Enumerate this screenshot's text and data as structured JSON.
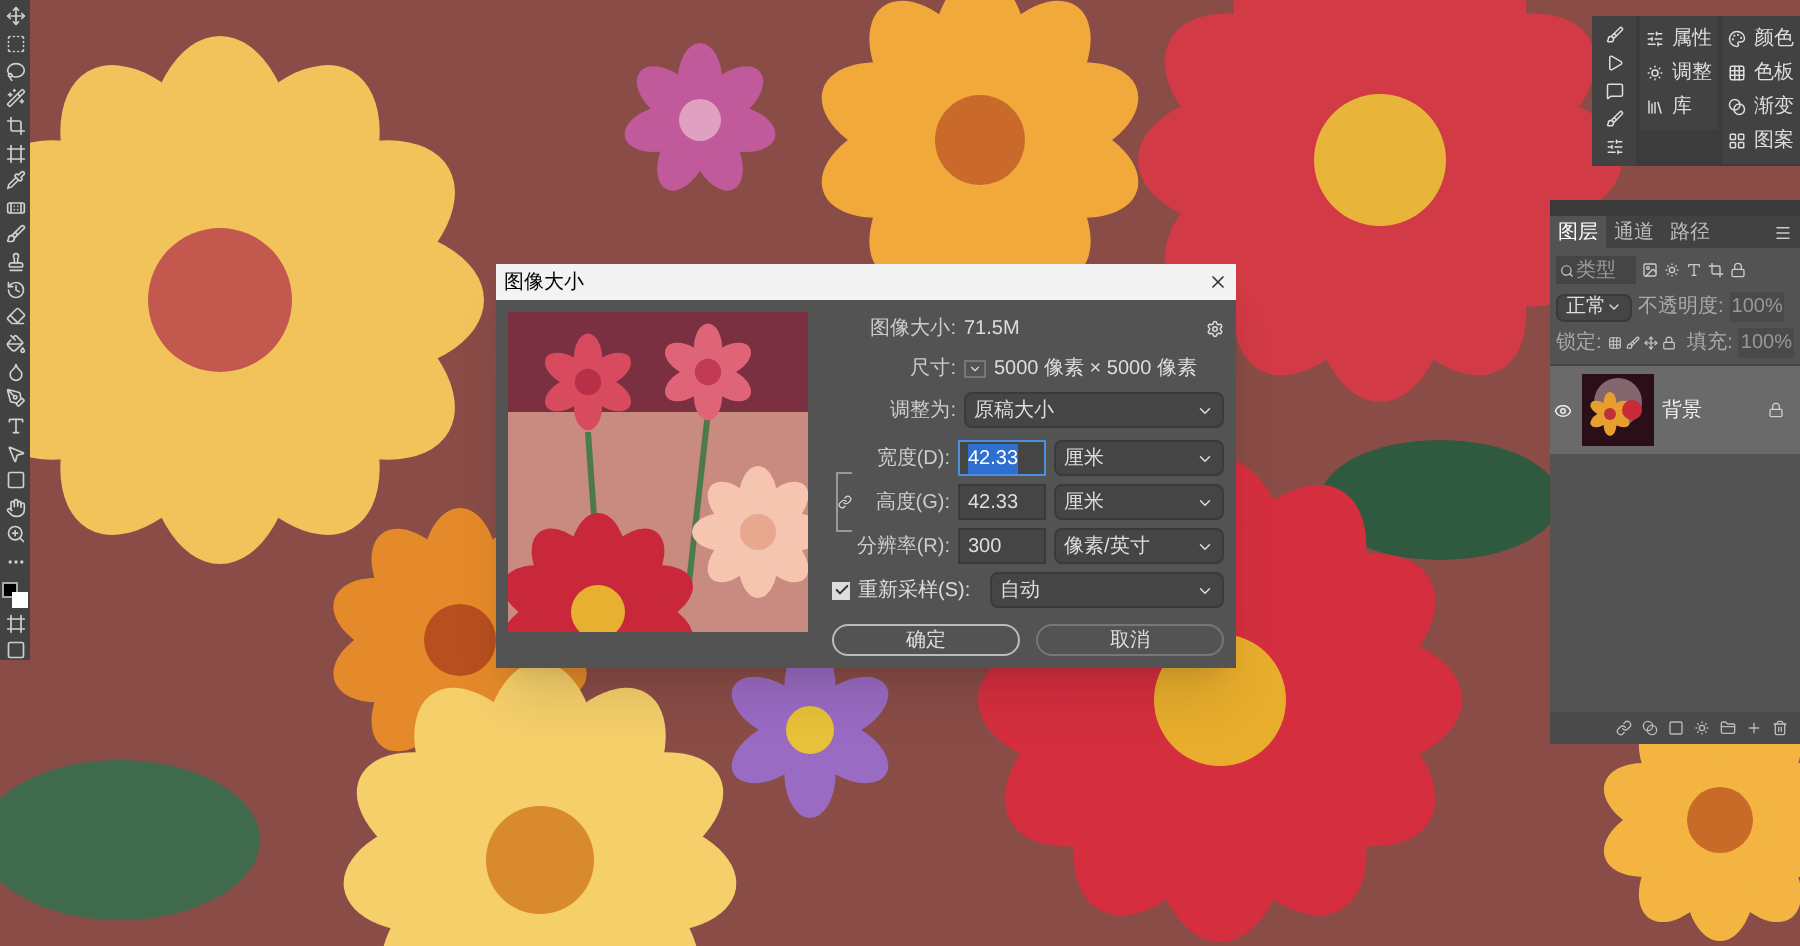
{
  "dialog": {
    "title": "图像大小",
    "image_size_label": "图像大小:",
    "image_size_value": "71.5M",
    "dimensions_label": "尺寸:",
    "dimensions_value": "5000 像素 × 5000 像素",
    "fit_label": "调整为:",
    "fit_value": "原稿大小",
    "constrain_proportions": true,
    "fields": [
      {
        "label": "宽度(D):",
        "value": "42.33",
        "unit": "厘米",
        "selected": true
      },
      {
        "label": "高度(G):",
        "value": "42.33",
        "unit": "厘米",
        "selected": false
      },
      {
        "label": "分辨率(R):",
        "value": "300",
        "unit": "像素/英寸",
        "selected": false
      }
    ],
    "resample": {
      "label": "重新采样(S):",
      "checked": true,
      "value": "自动"
    },
    "buttons": [
      {
        "label": "确定",
        "kind": "primary"
      },
      {
        "label": "取消",
        "kind": "secondary"
      }
    ]
  },
  "side_panels": [
    {
      "items": [
        "属性",
        "调整",
        "库"
      ]
    },
    {
      "items": [
        "颜色",
        "色板",
        "渐变",
        "图案"
      ]
    }
  ],
  "layers_panel": {
    "tabs": [
      {
        "label": "图层",
        "selected": true
      },
      {
        "label": "通道",
        "selected": false
      },
      {
        "label": "路径",
        "selected": false
      }
    ],
    "filter_placeholder": "类型",
    "blend_mode": "正常",
    "opacity_label": "不透明度:",
    "opacity": "100%",
    "lock_label": "锁定:",
    "fill_label": "填充:",
    "fill": "100%",
    "layers": [
      {
        "name": "背景",
        "visible": true,
        "locked": true,
        "selected": true
      }
    ]
  }
}
